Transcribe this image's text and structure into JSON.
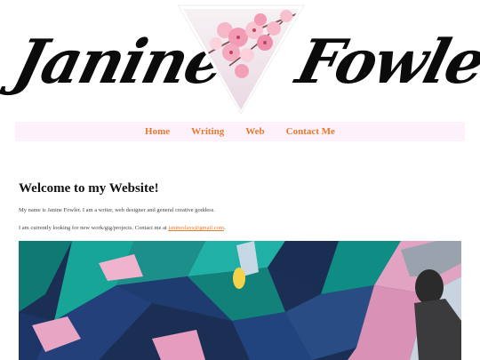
{
  "header": {
    "first_name": "Janine",
    "last_name": "Fowler",
    "logo_icon": "cherry-blossom-triangle-logo"
  },
  "nav": {
    "items": [
      {
        "label": "Home"
      },
      {
        "label": "Writing"
      },
      {
        "label": "Web"
      },
      {
        "label": "Contact Me"
      }
    ]
  },
  "main": {
    "heading": "Welcome to my Website!",
    "intro": "My name is Janine Fowler. I am a writer, web designer and general creative goddess.",
    "contact_prefix": "I am currently looking for new work/gig/projects. Contact me at ",
    "contact_email": "janineslays@gmail.com",
    "contact_suffix": ".",
    "hero_image": "graffiti-wall-photo"
  },
  "colors": {
    "link": "#e8792c",
    "nav_background": "#fdf1fb",
    "text": "#222222"
  }
}
